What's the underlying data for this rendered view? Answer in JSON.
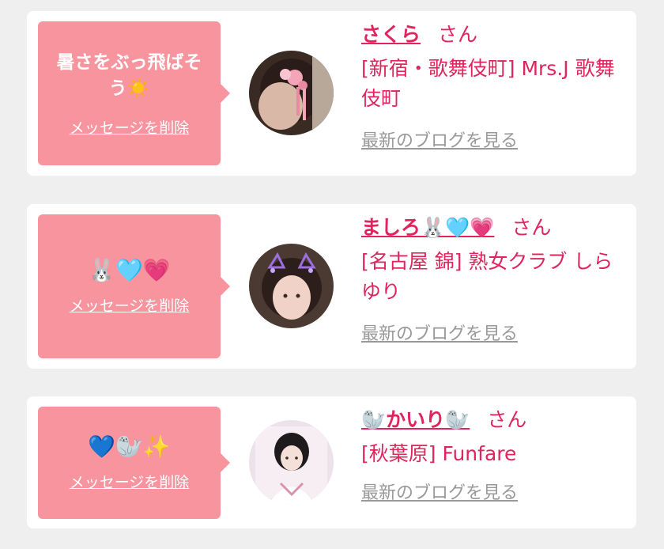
{
  "items": [
    {
      "message": "暑さをぶっ飛ばそう☀️",
      "delete_label": "メッセージを削除",
      "name": "さくら",
      "honorific": "さん",
      "shop": "[新宿・歌舞伎町] Mrs.J 歌舞伎町",
      "blog_label": "最新のブログを見る"
    },
    {
      "message": "🐰🩵💗",
      "delete_label": "メッセージを削除",
      "name": "ましろ🐰🩵💗",
      "honorific": "さん",
      "shop": "[名古屋 錦] 熟女クラブ しらゆり",
      "blog_label": "最新のブログを見る"
    },
    {
      "message": "💙🦭✨",
      "delete_label": "メッセージを削除",
      "name": "🦭かいり🦭",
      "honorific": "さん",
      "shop": "[秋葉原] Funfare",
      "blog_label": "最新のブログを見る"
    }
  ],
  "colors": {
    "bubble": "#f8949e",
    "accent": "#e0245e",
    "link_gray": "#999999"
  }
}
